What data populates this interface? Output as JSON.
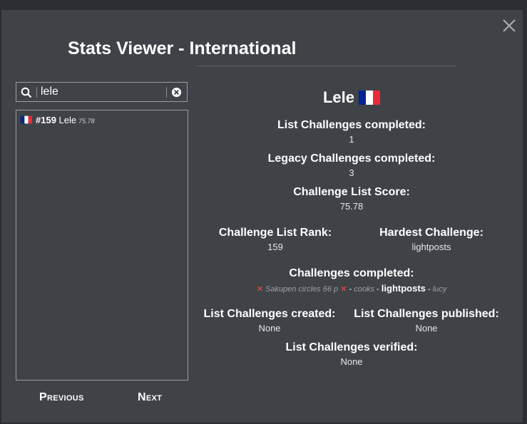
{
  "modal": {
    "title": "Stats Viewer - ",
    "title_region": "International"
  },
  "search": {
    "value": "lele",
    "placeholder": ""
  },
  "leaderboard": {
    "items": [
      {
        "rank": "#159",
        "name": "Lele",
        "score": "75.78",
        "flag": "france-flag-icon"
      }
    ]
  },
  "pagination": {
    "previous_label": "Previous",
    "next_label": "Next"
  },
  "player": {
    "name": "Lele",
    "flag": "france-flag-icon",
    "list_completed_label": "List Challenges completed:",
    "list_completed_value": "1",
    "legacy_completed_label": "Legacy Challenges completed:",
    "legacy_completed_value": "3",
    "score_label": "Challenge List Score:",
    "score_value": "75.78",
    "rank_label": "Challenge List Rank:",
    "rank_value": "159",
    "hardest_label": "Hardest Challenge:",
    "hardest_value": "lightposts",
    "challenges_completed_label": "Challenges completed:",
    "challenges_completed": [
      {
        "text": "Sakupen circles 66 p",
        "style": "failed"
      },
      {
        "text": "cooks",
        "style": "legacy"
      },
      {
        "text": "lightposts",
        "style": "list"
      },
      {
        "text": "lucy",
        "style": "legacy"
      }
    ],
    "separator": "-",
    "created_label": "List Challenges created:",
    "created_value": "None",
    "published_label": "List Challenges published:",
    "published_value": "None",
    "verified_label": "List Challenges verified:",
    "verified_value": "None"
  },
  "colors": {
    "background": "#3f4247",
    "outer": "#2b2e33",
    "fail": "#d04848",
    "flag_blue": "#002395",
    "flag_red": "#ed2939"
  }
}
